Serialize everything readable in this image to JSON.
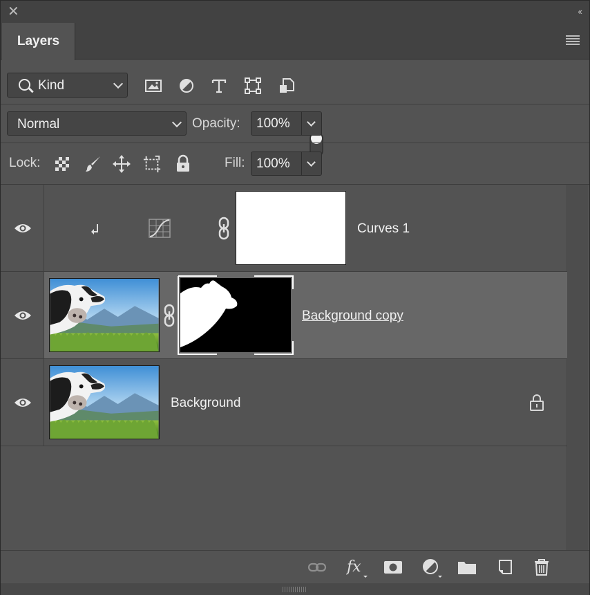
{
  "panel": {
    "tab_label": "Layers"
  },
  "filter": {
    "kind_label": "Kind",
    "icons": [
      "image-filter-icon",
      "adjustment-filter-icon",
      "type-filter-icon",
      "shape-filter-icon",
      "smart-object-filter-icon",
      "filter-toggle-icon"
    ]
  },
  "blend": {
    "mode": "Normal",
    "opacity_label": "Opacity:",
    "opacity_value": "100%"
  },
  "lock": {
    "label": "Lock:",
    "fill_label": "Fill:",
    "fill_value": "100%",
    "icons": [
      "lock-transparency-icon",
      "lock-paint-icon",
      "lock-position-icon",
      "lock-artboard-icon",
      "lock-all-icon"
    ]
  },
  "layers": [
    {
      "name": "Curves 1",
      "type": "adjustment",
      "visible": true
    },
    {
      "name": "Background copy",
      "type": "masked-pixel",
      "visible": true,
      "selected": true
    },
    {
      "name": "Background",
      "type": "pixel",
      "visible": true,
      "locked": true
    }
  ],
  "bottom_icons": [
    "link-layers-icon",
    "fx-icon",
    "add-mask-icon",
    "new-adjustment-icon",
    "new-group-icon",
    "new-layer-icon",
    "delete-icon"
  ],
  "colors": {
    "panel_bg": "#535353",
    "selected_row": "#676767",
    "header_bg": "#424242"
  }
}
